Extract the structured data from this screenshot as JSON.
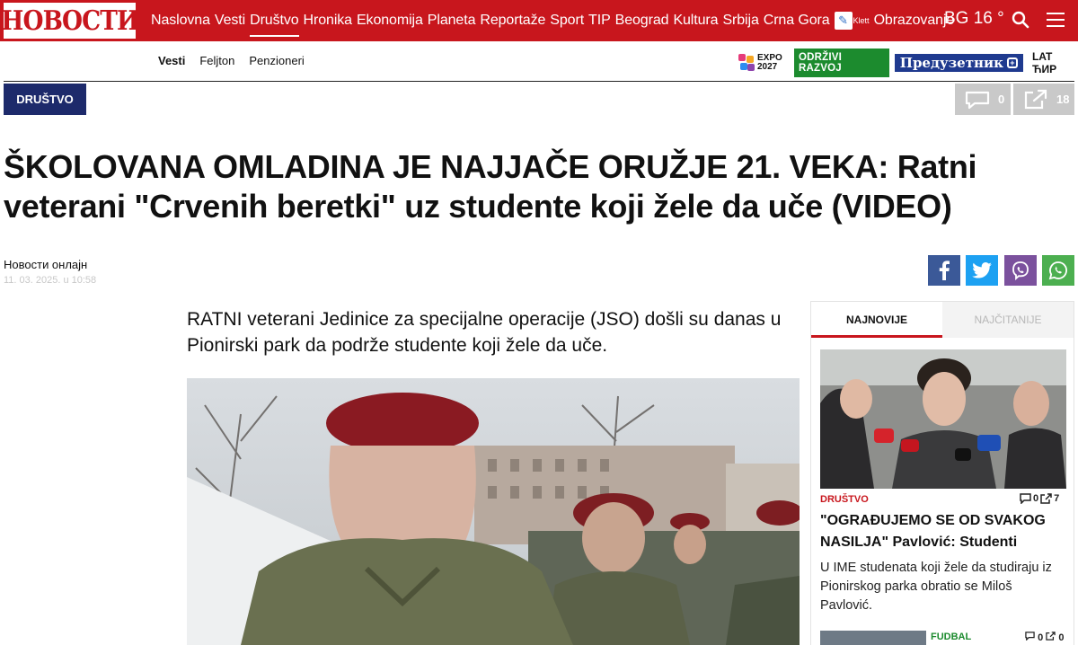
{
  "header": {
    "logo": "НОВОСТИ",
    "nav": [
      "Naslovna",
      "Vesti",
      "Društvo",
      "Hronika",
      "Ekonomija",
      "Planeta",
      "Reportaže",
      "Sport",
      "TIP",
      "Beograd",
      "Kultura",
      "Srbija",
      "Crna Gora"
    ],
    "nav_tail": "Obrazovanje",
    "klett_label": "Klett",
    "active_nav": "Društvo",
    "weather": "BG 16 °"
  },
  "subnav": [
    "Vesti",
    "Feljton",
    "Penzioneri"
  ],
  "partners": {
    "expo_line1": "EXPO",
    "expo_line2": "2027",
    "odrzivi": "ODRŽIVI RAZVOJ",
    "preduzetnik": "Предузетник",
    "lang": "LAT ЋИР"
  },
  "article": {
    "category": "DRUŠTVO",
    "comments": "0",
    "shares": "18",
    "title": "ŠKOLOVANA OMLADINA JE NAJJAČE ORUŽJE 21. VEKA: Ratni veterani \"Crvenih beretki\" uz studente koji žele da uče (VIDEO)",
    "author": "Новости онлајн",
    "date": "11. 03. 2025. u 10:58",
    "lead": "RATNI veterani Jedinice za specijalne operacije (JSO) došli su danas u Pionirski park da podrže studente koji žele da uče."
  },
  "sidebar": {
    "tab_latest": "NAJNOVIJE",
    "tab_popular": "NAJČITANIJE",
    "item": {
      "category": "DRUŠTVO",
      "comments": "0",
      "shares": "7",
      "title": "\"OGRAĐUJEMO SE OD SVAKOG NASILJA\" Pavlović: Studenti",
      "text": "U IME studenata koji žele da studiraju iz Pionirskog parka obratio se Miloš Pavlović."
    },
    "next": {
      "category": "FUDBAL",
      "comments": "0",
      "shares": "0"
    }
  },
  "colors": {
    "brand_red": "#c8161d",
    "category_navy": "#1d2a6b",
    "facebook": "#3b5998",
    "twitter": "#1da1f2",
    "viber": "#7b519d",
    "whatsapp": "#4caf50"
  }
}
